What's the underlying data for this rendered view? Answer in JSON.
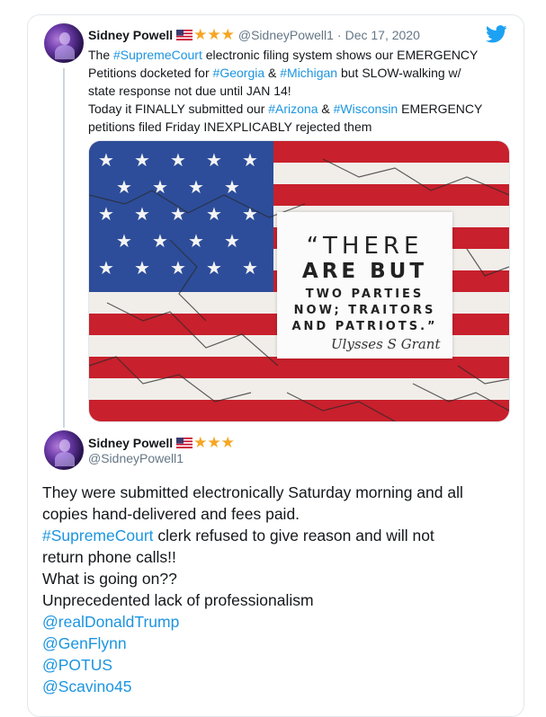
{
  "tweet1": {
    "author_name": "Sidney Powell",
    "flag_icon": "us-flag-icon",
    "stars": "★★★",
    "handle": "@SidneyPowell1",
    "separator": "·",
    "date": "Dec 17, 2020",
    "text_lines": [
      [
        {
          "t": "The ",
          "link": false
        },
        {
          "t": "#SupremeCourt",
          "link": true
        },
        {
          "t": " electronic filing system shows our EMERGENCY",
          "link": false
        }
      ],
      [
        {
          "t": "Petitions docketed for ",
          "link": false
        },
        {
          "t": "#Georgia",
          "link": true
        },
        {
          "t": " & ",
          "link": false
        },
        {
          "t": "#Michigan",
          "link": true
        },
        {
          "t": " but SLOW-walking w/",
          "link": false
        }
      ],
      [
        {
          "t": "state response not due until JAN 14!",
          "link": false
        }
      ],
      [
        {
          "t": "Today it FINALLY submitted our ",
          "link": false
        },
        {
          "t": "#Arizona",
          "link": true
        },
        {
          "t": " & ",
          "link": false
        },
        {
          "t": "#Wisconsin",
          "link": true
        },
        {
          "t": " EMERGENCY",
          "link": false
        }
      ],
      [
        {
          "t": "petitions filed Friday INEXPLICABLY rejected them",
          "link": false
        }
      ]
    ],
    "image": {
      "quote_line1": "“THERE",
      "quote_line2": "ARE BUT",
      "quote_line3": "TWO PARTIES",
      "quote_line4": "NOW; TRAITORS",
      "quote_line5": "AND PATRIOTS.”",
      "signature": "Ulysses S Grant"
    }
  },
  "tweet2": {
    "author_name": "Sidney Powell",
    "flag_icon": "us-flag-icon",
    "stars": "★★★",
    "handle": "@SidneyPowell1",
    "text_lines": [
      [
        {
          "t": "They were submitted electronically Saturday morning and all",
          "link": false
        }
      ],
      [
        {
          "t": "copies hand-delivered and fees paid.",
          "link": false
        }
      ],
      [
        {
          "t": "#SupremeCourt",
          "link": true
        },
        {
          "t": " clerk refused to give reason and will not",
          "link": false
        }
      ],
      [
        {
          "t": "return phone calls!!",
          "link": false
        }
      ],
      [
        {
          "t": "What is going on??",
          "link": false
        }
      ],
      [
        {
          "t": "Unprecedented lack of professionalism",
          "link": false
        }
      ],
      [
        {
          "t": "@realDonaldTrump",
          "link": true
        }
      ],
      [
        {
          "t": "@GenFlynn",
          "link": true
        }
      ],
      [
        {
          "t": "@POTUS",
          "link": true
        }
      ],
      [
        {
          "t": "@Scavino45",
          "link": true
        }
      ]
    ]
  },
  "colors": {
    "link": "#1b95e0",
    "star": "#f5a623",
    "twitter_blue": "#1da1f2",
    "muted": "#657786"
  },
  "icons": {
    "twitter": "twitter-bird-icon"
  }
}
